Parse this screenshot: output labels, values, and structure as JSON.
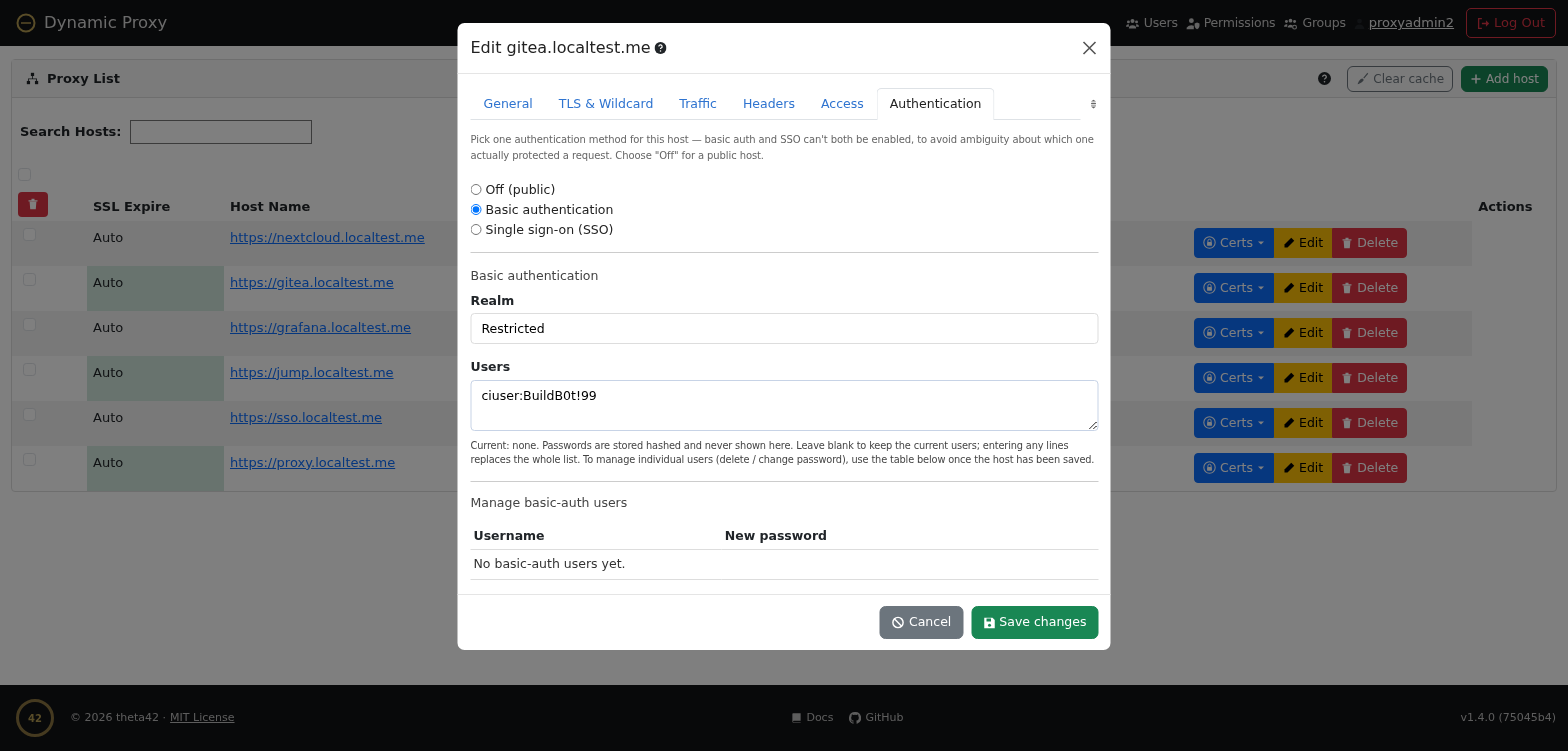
{
  "navbar": {
    "brand": "Dynamic Proxy",
    "items": [
      {
        "label": "Users"
      },
      {
        "label": "Permissions"
      },
      {
        "label": "Groups"
      }
    ],
    "user": "proxyadmin2",
    "logout": "Log Out"
  },
  "proxy_list": {
    "title": "Proxy List",
    "clear_cache": "Clear cache",
    "add_host": "Add host",
    "search_label": "Search Hosts:",
    "select_all_checked": false,
    "columns": [
      "SSL Expire",
      "Host Name",
      "Actions"
    ],
    "rows": [
      {
        "checked": false,
        "ssl_expire": "Auto",
        "host_name": "https://nextcloud.localtest.me",
        "certs": "Certs",
        "edit": "Edit",
        "delete": "Delete"
      },
      {
        "checked": false,
        "ssl_expire": "Auto",
        "host_name": "https://gitea.localtest.me",
        "certs": "Certs",
        "edit": "Edit",
        "delete": "Delete"
      },
      {
        "checked": false,
        "ssl_expire": "Auto",
        "host_name": "https://grafana.localtest.me",
        "certs": "Certs",
        "edit": "Edit",
        "delete": "Delete"
      },
      {
        "checked": false,
        "ssl_expire": "Auto",
        "host_name": "https://jump.localtest.me",
        "certs": "Certs",
        "edit": "Edit",
        "delete": "Delete"
      },
      {
        "checked": false,
        "ssl_expire": "Auto",
        "host_name": "https://sso.localtest.me",
        "certs": "Certs",
        "edit": "Edit",
        "delete": "Delete"
      },
      {
        "checked": false,
        "ssl_expire": "Auto",
        "host_name": "https://proxy.localtest.me",
        "certs": "Certs",
        "edit": "Edit",
        "delete": "Delete"
      }
    ]
  },
  "modal": {
    "title": "Edit gitea.localtest.me",
    "tabs": [
      {
        "label": "General",
        "selected": false
      },
      {
        "label": "TLS & Wildcard",
        "selected": false
      },
      {
        "label": "Traffic",
        "selected": false
      },
      {
        "label": "Headers",
        "selected": false
      },
      {
        "label": "Access",
        "selected": false
      },
      {
        "label": "Authentication",
        "selected": true
      }
    ],
    "intro": "Pick one authentication method for this host — basic auth and SSO can't both be enabled, to avoid ambiguity about which one actually protected a request. Choose \"Off\" for a public host.",
    "auth_options": [
      {
        "label": "Off (public)",
        "selected": false
      },
      {
        "label": "Basic authentication",
        "selected": true
      },
      {
        "label": "Single sign-on (SSO)",
        "selected": false
      }
    ],
    "section_title": "Basic authentication",
    "realm": {
      "label": "Realm",
      "value": "Restricted"
    },
    "users": {
      "label": "Users",
      "value": "ciuser:BuildB0t!99"
    },
    "users_help": "Current: none. Passwords are stored hashed and never shown here. Leave blank to keep the current users; entering any lines replaces the whole list. To manage individual users (delete / change password), use the table below once the host has been saved.",
    "manage_title": "Manage basic-auth users",
    "users_table": {
      "columns": [
        "Username",
        "New password"
      ],
      "empty_text": "No basic-auth users yet."
    },
    "buttons": [
      {
        "label": "Cancel",
        "kind": "cancel"
      },
      {
        "label": "Save changes",
        "kind": "save"
      }
    ]
  },
  "footer": {
    "logo_text": "42",
    "copyright": "© 2026 theta42 ·",
    "license": "MIT License",
    "links": [
      {
        "label": "Docs"
      },
      {
        "label": "GitHub"
      }
    ],
    "version": "v1.4.0 (75045b4)"
  }
}
